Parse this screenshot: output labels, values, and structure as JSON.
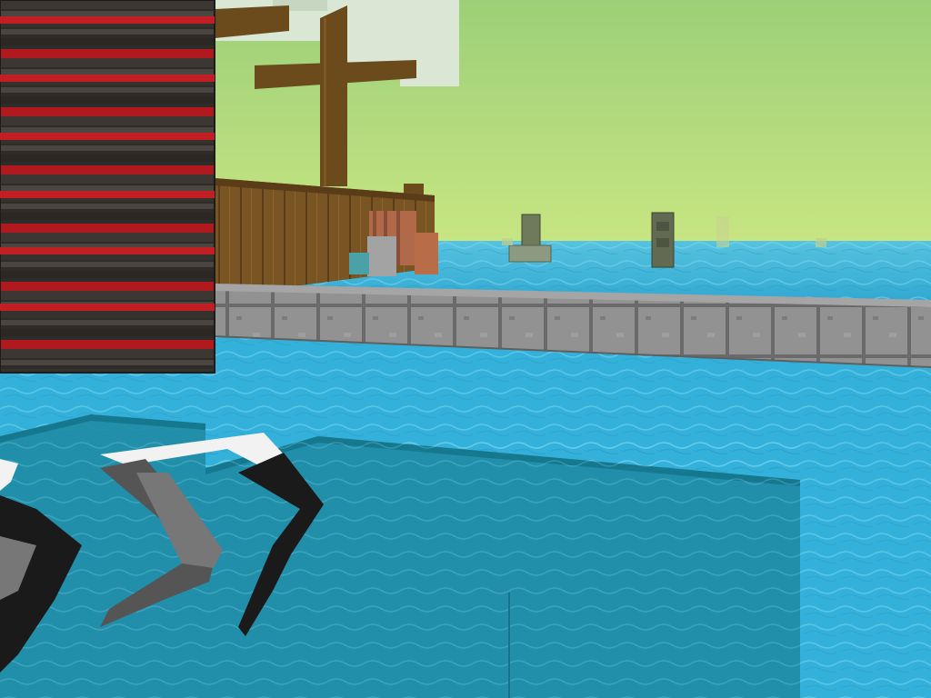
{
  "scene": {
    "kind": "voxel-game-first-person-view",
    "hud_text": []
  },
  "colors": {
    "sky_top": "#a8d87e",
    "sky_horizon": "#c6e67e",
    "water_light": "#3fb8dc",
    "water_mid": "#2aa6cf",
    "water_deep": "#1d7f9a",
    "stone": "#8a8a8a",
    "stone_edge": "#6e6e6e",
    "wood_dark": "#6b4a1c",
    "wood_plank": "#7a5524",
    "brick_red": "#b01a1f",
    "brick_dark": "#3a3632",
    "leaf_white": "#e6eee0",
    "pick_black": "#1a1a1a",
    "pick_white": "#f2f2f2",
    "pick_gray": "#777777"
  },
  "objects": {
    "left_wall": "striped-brick-wall",
    "ship_mast": "wooden-mast",
    "ship_hull": "wooden-hull",
    "stone_walkway": "stone-block-walkway",
    "distant_pillars": [
      "pillar-1",
      "pillar-2",
      "pillar-3",
      "pillar-4"
    ],
    "held_item": "pickaxe-icon"
  }
}
